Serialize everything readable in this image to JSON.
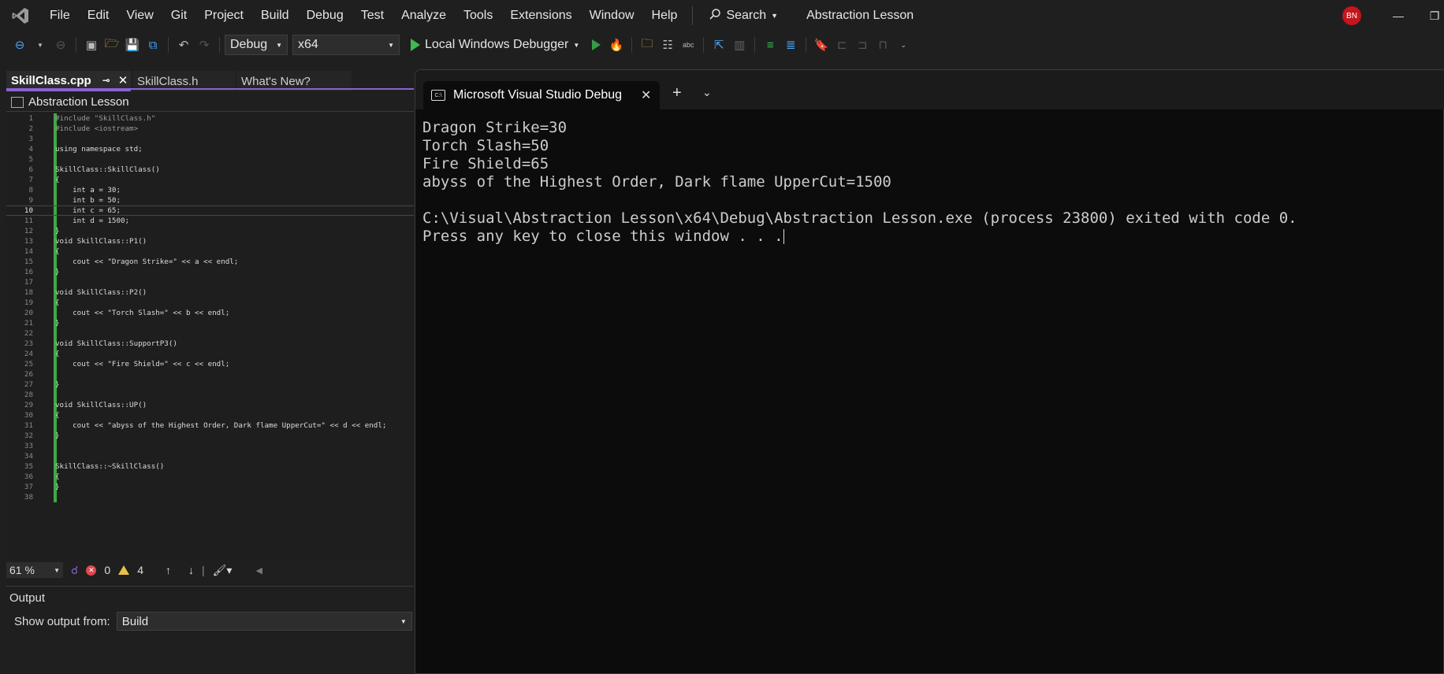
{
  "menubar": {
    "items": [
      "File",
      "Edit",
      "View",
      "Git",
      "Project",
      "Build",
      "Debug",
      "Test",
      "Analyze",
      "Tools",
      "Extensions",
      "Window",
      "Help"
    ],
    "search_label": "Search",
    "title": "Abstraction Lesson",
    "avatar_initials": "BN"
  },
  "toolbar": {
    "configuration": "Debug",
    "platform": "x64",
    "run_label": "Local Windows Debugger"
  },
  "editor": {
    "tabs": [
      {
        "label": "SkillClass.cpp",
        "active": true
      },
      {
        "label": "SkillClass.h",
        "active": false
      },
      {
        "label": "What's New?",
        "active": false
      }
    ],
    "nav_project": "Abstraction Lesson",
    "lines": [
      "#include \"SkillClass.h\"",
      "#include <iostream>",
      "",
      "using namespace std;",
      "",
      "SkillClass::SkillClass()",
      "{",
      "    int a = 30;",
      "    int b = 50;",
      "    int c = 65;",
      "    int d = 1500;",
      "}",
      "void SkillClass::P1()",
      "{",
      "    cout << \"Dragon Strike=\" << a << endl;",
      "}",
      "",
      "void SkillClass::P2()",
      "{",
      "    cout << \"Torch Slash=\" << b << endl;",
      "}",
      "",
      "void SkillClass::SupportP3()",
      "{",
      "    cout << \"Fire Shield=\" << c << endl;",
      "",
      "}",
      "",
      "void SkillClass::UP()",
      "{",
      "    cout << \"abyss of the Highest Order, Dark flame UpperCut=\" << d << endl;",
      "}",
      "",
      "",
      "SkillClass::~SkillClass()",
      "{",
      "}",
      ""
    ],
    "current_line": 10,
    "status": {
      "zoom": "61 %",
      "errors": "0",
      "warnings": "4"
    }
  },
  "output": {
    "title": "Output",
    "show_from_label": "Show output from:",
    "show_from_value": "Build"
  },
  "terminal": {
    "tab_title": "Microsoft Visual Studio Debuɡ",
    "lines": [
      "Dragon Strike=30",
      "Torch Slash=50",
      "Fire Shield=65",
      "abyss of the Highest Order, Dark flame UpperCut=1500",
      "",
      "C:\\Visual\\Abstraction Lesson\\x64\\Debug\\Abstraction Lesson.exe (process 23800) exited with code 0.",
      "Press any key to close this window . . ."
    ]
  },
  "icons": {
    "colors": {
      "accent": "#8a63d2",
      "run": "#3fb950",
      "error": "#e0474f",
      "warning": "#e8c04a",
      "change_bar": "#3fa845"
    }
  }
}
